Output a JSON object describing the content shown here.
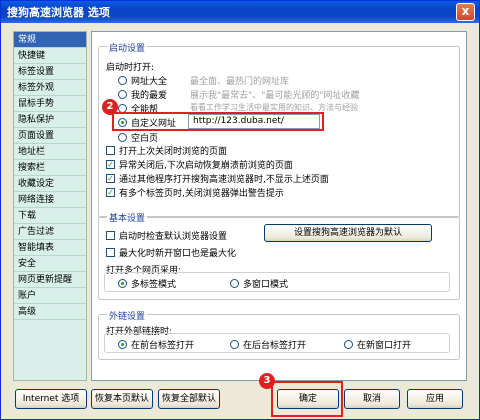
{
  "window": {
    "title": "搜狗高速浏览器 选项",
    "close": "x"
  },
  "sidebar": {
    "items": [
      {
        "label": "常规",
        "selected": true
      },
      {
        "label": "快捷键"
      },
      {
        "label": "标签设置"
      },
      {
        "label": "标签外观"
      },
      {
        "label": "鼠标手势"
      },
      {
        "label": "隐私保护"
      },
      {
        "label": "页面设置"
      },
      {
        "label": "地址栏"
      },
      {
        "label": "搜索栏"
      },
      {
        "label": "收藏设定"
      },
      {
        "label": "网络连接"
      },
      {
        "label": "下载"
      },
      {
        "label": "广告过滤"
      },
      {
        "label": "智能填表"
      },
      {
        "label": "安全"
      },
      {
        "label": "网页更新提醒"
      },
      {
        "label": "账户"
      },
      {
        "label": "高级"
      }
    ]
  },
  "startup": {
    "title": "启动设置",
    "open_label": "启动时打开:",
    "options": [
      {
        "label": "网址大全",
        "desc": "最全面、最热门的网址库"
      },
      {
        "label": "我的最爱",
        "desc": "展示我\"最常去\"、\"最可能光顾的\"网址收藏"
      },
      {
        "label": "全能帮",
        "desc": "看看工作学习生活中最实用的知识、方法与经验"
      },
      {
        "label": "自定义网址",
        "selected": true,
        "url": "http://123.duba.net/"
      },
      {
        "label": "空白页"
      }
    ],
    "checks": [
      {
        "label": "打开上次关闭时浏览的页面",
        "checked": false
      },
      {
        "label": "异常关闭后,下次启动恢复崩溃前浏览的页面",
        "checked": true
      },
      {
        "label": "通过其他程序打开搜狗高速浏览器时,不显示上述页面",
        "checked": true
      },
      {
        "label": "有多个标签页时,关闭浏览器弹出警告提示",
        "checked": true
      }
    ]
  },
  "basic": {
    "title": "基本设置",
    "check_default": "启动时检查默认浏览器设置",
    "set_default_button": "设置搜狗高速浏览器为默认",
    "maximize": "最大化时新开窗口也是最大化",
    "multi_label": "打开多个网页采用:",
    "multi_tab": "多标签模式",
    "multi_window": "多窗口模式"
  },
  "external": {
    "title": "外链设置",
    "open_label": "打开外部链接时:",
    "opt1": "在前台标签打开",
    "opt2": "在后台标签打开",
    "opt3": "在新窗口打开"
  },
  "footer": {
    "internet": "Internet 选项",
    "restore_page": "恢复本页默认",
    "restore_all": "恢复全部默认",
    "ok": "确定",
    "cancel": "取消",
    "apply": "应用"
  },
  "badges": {
    "b2": "2",
    "b3": "3"
  },
  "colors": {
    "highlight": "#e02020",
    "selected_bg": "#3164b4"
  }
}
